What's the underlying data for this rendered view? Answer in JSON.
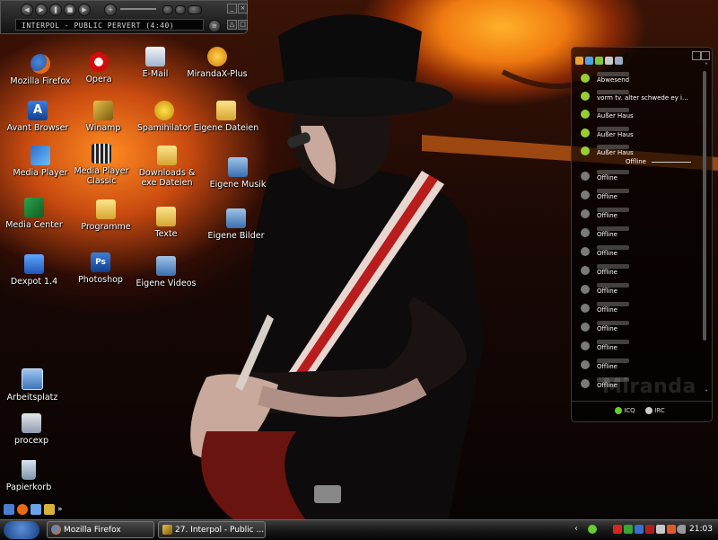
{
  "winamp": {
    "track_title": "INTERPOL - PUBLIC PERVERT (4:40)"
  },
  "desktop": {
    "icons": [
      {
        "label": "Mozilla Firefox",
        "icon": "firefox-icon"
      },
      {
        "label": "Avant Browser",
        "icon": "avant-browser-icon"
      },
      {
        "label": "Media Player",
        "icon": "media-player-icon"
      },
      {
        "label": "Media Center",
        "icon": "media-center-icon"
      },
      {
        "label": "Dexpot 1.4",
        "icon": "dexpot-icon"
      },
      {
        "label": "Arbeitsplatz",
        "icon": "computer-icon"
      },
      {
        "label": "procexp",
        "icon": "process-explorer-icon"
      },
      {
        "label": "Papierkorb",
        "icon": "recycle-bin-icon"
      },
      {
        "label": "Opera",
        "icon": "opera-icon"
      },
      {
        "label": "Winamp",
        "icon": "winamp-icon"
      },
      {
        "label": "Media Player Classic",
        "icon": "media-player-classic-icon"
      },
      {
        "label": "Programme",
        "icon": "folder-icon"
      },
      {
        "label": "Photoshop",
        "icon": "photoshop-icon"
      },
      {
        "label": "E-Mail",
        "icon": "email-icon"
      },
      {
        "label": "Spamihilator",
        "icon": "spamihilator-icon"
      },
      {
        "label": "Downloads & exe Dateien",
        "icon": "folder-icon"
      },
      {
        "label": "Texte",
        "icon": "folder-icon"
      },
      {
        "label": "Eigene Videos",
        "icon": "videos-folder-icon"
      },
      {
        "label": "MirandaX-Plus",
        "icon": "miranda-icon"
      },
      {
        "label": "Eigene Dateien",
        "icon": "folder-icon"
      },
      {
        "label": "Eigene Musik",
        "icon": "music-folder-icon"
      },
      {
        "label": "Eigene Bilder",
        "icon": "pictures-folder-icon"
      }
    ]
  },
  "miranda": {
    "contacts": [
      {
        "status": "Abwesend",
        "color": "#9acd32"
      },
      {
        "status": "vorm tv. alter schwede ey i...",
        "color": "#9acd32"
      },
      {
        "status": "Außer Haus",
        "color": "#9acd32"
      },
      {
        "status": "Außer Haus",
        "color": "#9acd32"
      },
      {
        "status": "Außer Haus",
        "color": "#9acd32"
      }
    ],
    "offline_group": "Offline",
    "offline_contacts": [
      {
        "status": "Offline"
      },
      {
        "status": "Offline"
      },
      {
        "status": "Offline"
      },
      {
        "status": "Offline"
      },
      {
        "status": "Offline"
      },
      {
        "status": "Offline"
      },
      {
        "status": "Offline"
      },
      {
        "status": "Offline"
      },
      {
        "status": "Offline"
      },
      {
        "status": "Offline"
      },
      {
        "status": "Offline"
      },
      {
        "status": "Offline"
      }
    ],
    "watermark": "Miranda",
    "protocols": [
      {
        "label": "ICQ",
        "color": "#66cc33"
      },
      {
        "label": "IRC",
        "color": "#cccccc"
      }
    ]
  },
  "taskbar": {
    "tasks": [
      {
        "label": "Mozilla Firefox",
        "icon": "firefox-icon"
      },
      {
        "label": "27. Interpol - Public ...",
        "icon": "winamp-icon"
      }
    ],
    "clock": "21:03"
  }
}
